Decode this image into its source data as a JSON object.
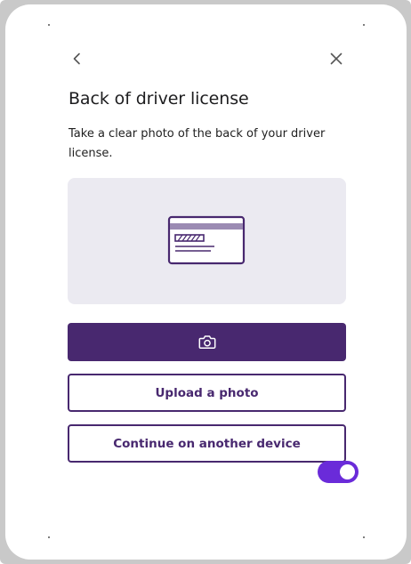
{
  "header": {
    "back_icon": "chevron-left-icon",
    "close_icon": "close-icon"
  },
  "title": "Back of driver license",
  "description": "Take a clear photo of the back of your driver license.",
  "illustration": {
    "icon": "card-back-icon"
  },
  "buttons": {
    "camera_icon": "camera-icon",
    "upload_label": "Upload a photo",
    "continue_label": "Continue on another device"
  },
  "toggle": {
    "on": true
  },
  "colors": {
    "primary": "#48286f",
    "illustration_bg": "#ebeaf1",
    "toggle": "#6a2bd9",
    "icon_stroke": "#48286f"
  }
}
